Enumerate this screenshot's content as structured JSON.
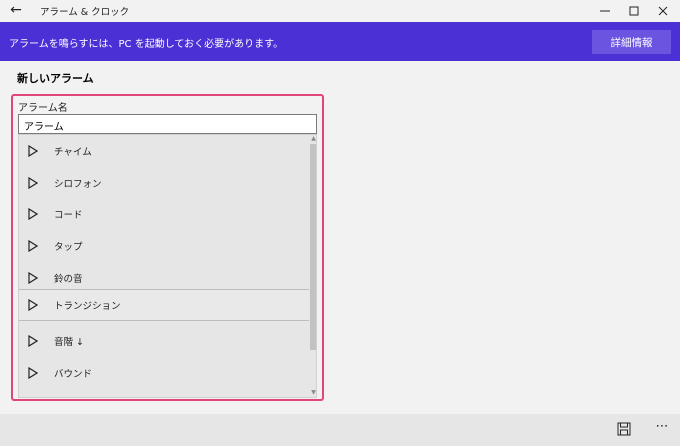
{
  "window": {
    "title": "アラーム & クロック",
    "back_glyph": "←",
    "minimize_glyph": "—",
    "maximize_glyph": "☐",
    "close_glyph": "✕"
  },
  "banner": {
    "message": "アラームを鳴らすには、PC を起動しておく必要があります。",
    "more_info_label": "詳細情報",
    "color": "#4b30d5"
  },
  "page": {
    "heading": "新しいアラーム"
  },
  "alarm_name": {
    "label": "アラーム名",
    "value": "アラーム"
  },
  "sounds": [
    {
      "label": "チャイム",
      "selected": false
    },
    {
      "label": "シロフォン",
      "selected": false
    },
    {
      "label": "コード",
      "selected": false
    },
    {
      "label": "タップ",
      "selected": false
    },
    {
      "label": "鈴の音",
      "selected": false
    },
    {
      "label": "トランジション",
      "selected": true
    },
    {
      "label": "音階 ↓",
      "selected": false
    },
    {
      "label": "バウンド",
      "selected": false
    }
  ],
  "colors": {
    "focus_border": "#e0457b",
    "background": "#f2f2f2"
  },
  "bottombar": {
    "more_glyph": "⋯"
  }
}
